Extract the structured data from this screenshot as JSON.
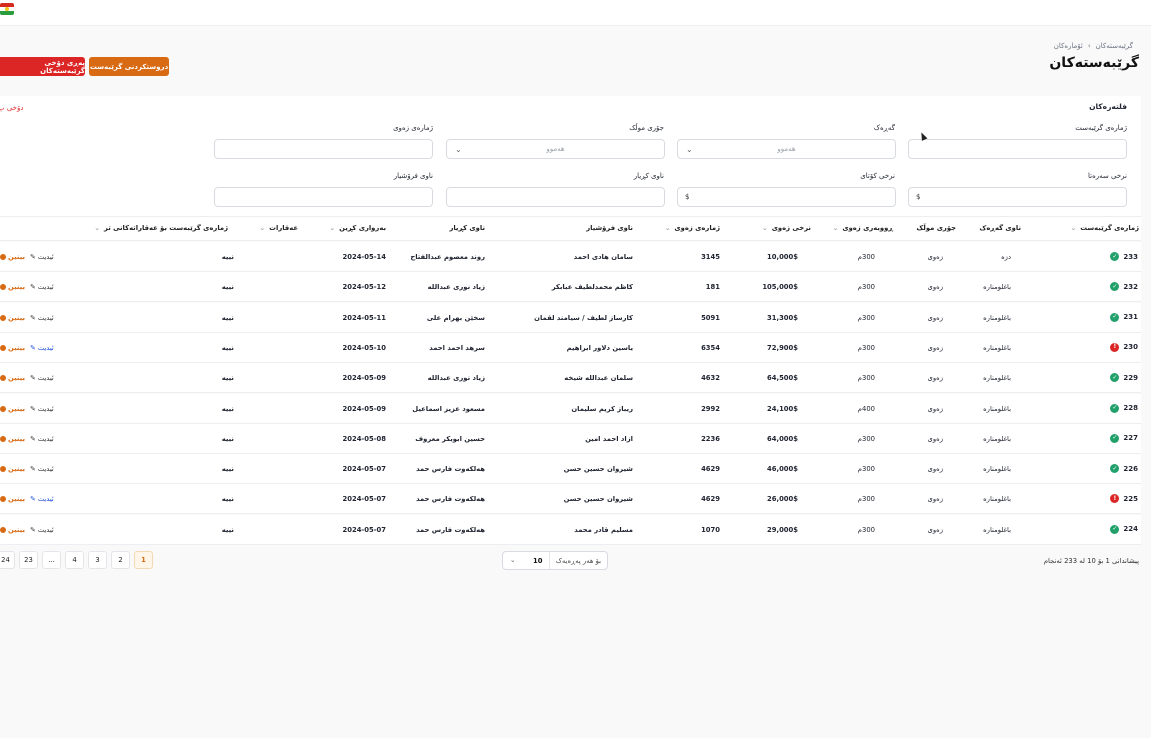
{
  "breadcrumb": {
    "first": "گرێبەستەکان",
    "sep": "›",
    "second": "ئۆمارەکان"
  },
  "page_title": "گرێبەستەکان",
  "actions": {
    "create_label": "دروستکردنی گرێبەست",
    "red_label": "پەڕی دۆخی گرێبەستەکان"
  },
  "filters": {
    "title": "فلتەرەکان",
    "left_link": "دۆخی پ",
    "contract_no": {
      "label": "ژمارەی گرێبەست",
      "value": ""
    },
    "phase": {
      "label": "گەڕەک",
      "selected": "هەموو"
    },
    "property_type": {
      "label": "جۆری موڵک",
      "selected": "هەموو"
    },
    "land_no": {
      "label": "ژمارەی زەوی",
      "value": ""
    },
    "start_price": {
      "label": "نرخی سەرەتا",
      "prefix": "$"
    },
    "final_price": {
      "label": "نرخی کۆتای",
      "prefix": "$"
    },
    "buyer_name": {
      "label": "ناوی کڕیار",
      "value": ""
    },
    "seller_name": {
      "label": "ناوی فرۆشیار",
      "value": ""
    }
  },
  "table": {
    "headers": {
      "contract_no": "ژمارەی گرێبەست",
      "phase_name": "ناوی گەڕەک",
      "property_type": "جۆری موڵک",
      "area": "ڕووبەری زەوی",
      "land_price": "نرخی زەوی",
      "land_no": "ژمارەی زەوی",
      "seller": "ناوی فرۆشیار",
      "buyer": "ناوی کڕیار",
      "date": "بەرواری کڕین",
      "property": "عەقارات",
      "related": "ژمارەی گرێبەست بۆ عەقاراتەکانی تر"
    },
    "rows": [
      {
        "id": "233",
        "status": "ok",
        "phase": "دزە",
        "type": "زەوی",
        "area": "300م",
        "price": "10,000$",
        "land": "3145",
        "seller": "سامان هادی احمد",
        "buyer": "روند معصوم عبدالفتاح",
        "date": "2024-05-14",
        "prop": "نییە",
        "view": "بینین",
        "edit": "ئیدیت",
        "edit_blue": false
      },
      {
        "id": "232",
        "status": "ok",
        "phase": "باغلومنارە",
        "type": "زەوی",
        "area": "300م",
        "price": "105,000$",
        "land": "181",
        "seller": "کاظم محمدلطیف عبابکر",
        "buyer": "زیاد نوری عبداللە",
        "date": "2024-05-12",
        "prop": "نییە",
        "view": "بینین",
        "edit": "ئیدیت",
        "edit_blue": false
      },
      {
        "id": "231",
        "status": "ok",
        "phase": "باغلومنارە",
        "type": "زەوی",
        "area": "300م",
        "price": "31,300$",
        "land": "5091",
        "seller": "کارساز لطیف / سیامند لقمان",
        "buyer": "سخێن بهرام علی",
        "date": "2024-05-11",
        "prop": "نییە",
        "view": "بینین",
        "edit": "ئیدیت",
        "edit_blue": false
      },
      {
        "id": "230",
        "status": "bad",
        "phase": "باغلومنارە",
        "type": "زەوی",
        "area": "300م",
        "price": "72,900$",
        "land": "6354",
        "seller": "یاسین دلاور ابراهیم",
        "buyer": "سرهد احمد احمد",
        "date": "2024-05-10",
        "prop": "نییە",
        "view": "بینین",
        "edit": "ئیدیت",
        "edit_blue": true
      },
      {
        "id": "229",
        "status": "ok",
        "phase": "باغلومنارە",
        "type": "زەوی",
        "area": "300م",
        "price": "64,500$",
        "land": "4632",
        "seller": "سلمان عبداللە شیخە",
        "buyer": "زیاد نوری عبداللە",
        "date": "2024-05-09",
        "prop": "نییە",
        "view": "بینین",
        "edit": "ئیدیت",
        "edit_blue": false
      },
      {
        "id": "228",
        "status": "ok",
        "phase": "باغلومنارە",
        "type": "زەوی",
        "area": "400م",
        "price": "24,100$",
        "land": "2992",
        "seller": "ریباز کریم سلیمان",
        "buyer": "مسعود عزیز اسماعیل",
        "date": "2024-05-09",
        "prop": "نییە",
        "view": "بینین",
        "edit": "ئیدیت",
        "edit_blue": false
      },
      {
        "id": "227",
        "status": "ok",
        "phase": "باغلومنارە",
        "type": "زەوی",
        "area": "300م",
        "price": "64,000$",
        "land": "2236",
        "seller": "ازاد احمد امین",
        "buyer": "حسین ابوبکر معروف",
        "date": "2024-05-08",
        "prop": "نییە",
        "view": "بینین",
        "edit": "ئیدیت",
        "edit_blue": false
      },
      {
        "id": "226",
        "status": "ok",
        "phase": "باغلومنارە",
        "type": "زەوی",
        "area": "300م",
        "price": "46,000$",
        "land": "4629",
        "seller": "شیروان حسین حسن",
        "buyer": "هەلکەوت فارس حمد",
        "date": "2024-05-07",
        "prop": "نییە",
        "view": "بینین",
        "edit": "ئیدیت",
        "edit_blue": false
      },
      {
        "id": "225",
        "status": "bad",
        "phase": "باغلومنارە",
        "type": "زەوی",
        "area": "300م",
        "price": "26,000$",
        "land": "4629",
        "seller": "شیروان حسین حسن",
        "buyer": "هەلکەوت فارس حمد",
        "date": "2024-05-07",
        "prop": "نییە",
        "view": "بینین",
        "edit": "ئیدیت",
        "edit_blue": true
      },
      {
        "id": "224",
        "status": "ok",
        "phase": "باغلومنارە",
        "type": "زەوی",
        "area": "300م",
        "price": "29,000$",
        "land": "1070",
        "seller": "مسلیم قادر محمد",
        "buyer": "هەلکەوت فارس حمد",
        "date": "2024-05-07",
        "prop": "نییە",
        "view": "بینین",
        "edit": "ئیدیت",
        "edit_blue": false
      }
    ]
  },
  "pagination": {
    "pages": [
      "24",
      "23",
      "...",
      "4",
      "3",
      "2",
      "1"
    ],
    "current": "1",
    "per_page_label": "بۆ هەر پەڕەیەک",
    "per_page": "10",
    "showing": "پیشاندانی 1 بۆ 10 لە 233 ئەنجام"
  },
  "colors": {
    "accent": "#d96a14",
    "danger": "#dc2626",
    "success": "#22a06b"
  }
}
